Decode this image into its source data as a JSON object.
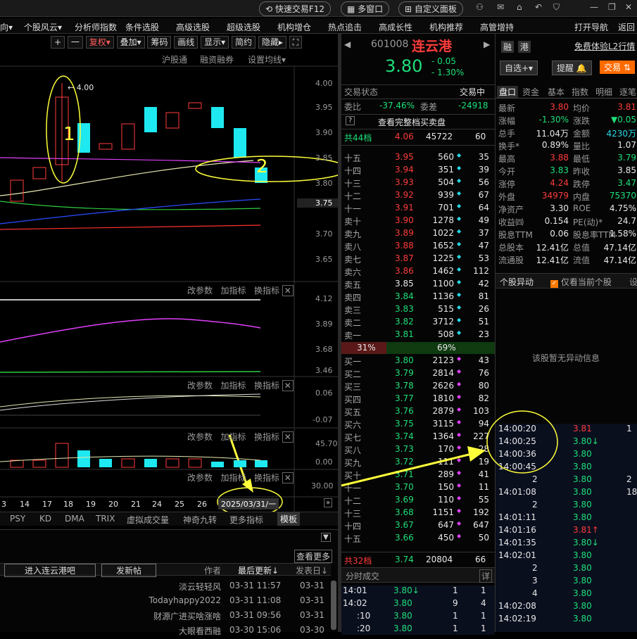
{
  "topbar": {
    "buttons": [
      "快速交易F12",
      "多窗口",
      "自定义面板"
    ]
  },
  "menubar": {
    "items": [
      "向▾",
      "个股风云▾",
      "分析师指数",
      "条件选股",
      "高级选股",
      "超级选股",
      "机构增仓",
      "热点追击",
      "高成长性",
      "机构推荐",
      "高管增持"
    ],
    "right_items": [
      "打开导航",
      "返回"
    ]
  },
  "chart_toolbar": {
    "buttons": [
      "+",
      "一",
      "复权▾",
      "叠加▾",
      "筹码",
      "画线",
      "显示▾",
      "简约",
      "隐藏▸"
    ],
    "sub_links": [
      "沪股通",
      "融资融券",
      "设置均线▾"
    ]
  },
  "price_axis": [
    "4.00",
    "3.95",
    "3.90",
    "3.85",
    "3.80",
    "3.75",
    "3.70",
    "3.65"
  ],
  "high_label": "4.00",
  "annotations": [
    "1",
    "2"
  ],
  "indicator_panels": [
    {
      "links": [
        "改参数",
        "加指标",
        "换指标"
      ],
      "axis": [
        "4.12",
        "3.89",
        "3.68",
        "3.46"
      ]
    },
    {
      "links": [
        "改参数",
        "加指标",
        "换指标"
      ],
      "axis": [
        "0.06",
        "-0.07"
      ]
    },
    {
      "links": [
        "改参数",
        "加指标",
        "换指标"
      ],
      "axis": [
        "45.70",
        "0.00"
      ]
    },
    {
      "links": [
        "改参数",
        "加指标",
        "换指标"
      ],
      "axis": [
        "30.00"
      ]
    }
  ],
  "date_axis": [
    "3",
    "14",
    "17",
    "18",
    "19",
    "20",
    "21",
    "24",
    "25",
    "26"
  ],
  "date_box": "2025/03/31/一",
  "indicator_tabs": [
    "PSY",
    "KD",
    "DMA",
    "TRIX",
    "虚拟成交量",
    "神奇九转",
    "更多指标",
    "模板"
  ],
  "forum": {
    "view_more": "查看更多",
    "enter_btn": "进入连云港吧",
    "post_btn": "发新帖",
    "headers": [
      "作者",
      "最后更新↓",
      "发表日↓"
    ],
    "rows": [
      {
        "author": "淡云轻轻风",
        "updated": "03-31 11:57",
        "posted": "03-31"
      },
      {
        "author": "Todayhappy2022",
        "updated": "03-31 11:08",
        "posted": "03-31"
      },
      {
        "author": "财源广进买啥涨啥",
        "updated": "03-31 09:56",
        "posted": "03-31"
      },
      {
        "author": "大眼看西融",
        "updated": "03-30 15:06",
        "posted": "03-30"
      }
    ]
  },
  "stock": {
    "code": "601008",
    "name": "连云港",
    "price": "3.80",
    "change": "- 0.05",
    "change_pct": "- 1.30%",
    "status_label": "交易状态",
    "status": "交易中",
    "weibi_label": "委比",
    "weibi": "-37.46%",
    "weicha_label": "委差",
    "weicha": "-24918",
    "full_depth": "查看完整档买卖盘",
    "sell_total_label": "共44档",
    "sell_total_price": "4.06",
    "sell_total_vol": "45722",
    "sell_total_n": "60",
    "buy_total_label": "共32档",
    "buy_total_price": "3.74",
    "buy_total_vol": "20804",
    "buy_total_n": "66",
    "ratio_sell": "31%",
    "ratio_buy": "69%"
  },
  "asks": [
    {
      "label": "十五",
      "price": "3.95",
      "vol": "560",
      "n": "35"
    },
    {
      "label": "十四",
      "price": "3.94",
      "vol": "351",
      "n": "39"
    },
    {
      "label": "十三",
      "price": "3.93",
      "vol": "504",
      "n": "56"
    },
    {
      "label": "十二",
      "price": "3.92",
      "vol": "939",
      "n": "67"
    },
    {
      "label": "十一",
      "price": "3.91",
      "vol": "701",
      "n": "64"
    },
    {
      "label": "卖十",
      "price": "3.90",
      "vol": "1278",
      "n": "49"
    },
    {
      "label": "卖九",
      "price": "3.89",
      "vol": "1022",
      "n": "37"
    },
    {
      "label": "卖八",
      "price": "3.88",
      "vol": "1652",
      "n": "47"
    },
    {
      "label": "卖七",
      "price": "3.87",
      "vol": "1225",
      "n": "53"
    },
    {
      "label": "卖六",
      "price": "3.86",
      "vol": "1462",
      "n": "112"
    },
    {
      "label": "卖五",
      "price": "3.85",
      "vol": "1100",
      "n": "42"
    },
    {
      "label": "卖四",
      "price": "3.84",
      "vol": "1136",
      "n": "81"
    },
    {
      "label": "卖三",
      "price": "3.83",
      "vol": "515",
      "n": "26"
    },
    {
      "label": "卖二",
      "price": "3.82",
      "vol": "3712",
      "n": "51"
    },
    {
      "label": "卖一",
      "price": "3.81",
      "vol": "508",
      "n": "23"
    }
  ],
  "bids": [
    {
      "label": "买一",
      "price": "3.80",
      "vol": "2123",
      "n": "43"
    },
    {
      "label": "买二",
      "price": "3.79",
      "vol": "2814",
      "n": "76"
    },
    {
      "label": "买三",
      "price": "3.78",
      "vol": "2626",
      "n": "80"
    },
    {
      "label": "买四",
      "price": "3.77",
      "vol": "1810",
      "n": "82"
    },
    {
      "label": "买五",
      "price": "3.76",
      "vol": "2879",
      "n": "103"
    },
    {
      "label": "买六",
      "price": "3.75",
      "vol": "3115",
      "n": "94"
    },
    {
      "label": "买七",
      "price": "3.74",
      "vol": "1364",
      "n": "227"
    },
    {
      "label": "买八",
      "price": "3.73",
      "vol": "170",
      "n": "28"
    },
    {
      "label": "买九",
      "price": "3.72",
      "vol": "111",
      "n": "19"
    },
    {
      "label": "买十",
      "price": "3.71",
      "vol": "289",
      "n": "41"
    },
    {
      "label": "十一",
      "price": "3.70",
      "vol": "150",
      "n": "11"
    },
    {
      "label": "十二",
      "price": "3.69",
      "vol": "110",
      "n": "55"
    },
    {
      "label": "十三",
      "price": "3.68",
      "vol": "1151",
      "n": "192"
    },
    {
      "label": "十四",
      "price": "3.67",
      "vol": "647",
      "n": "647"
    },
    {
      "label": "十五",
      "price": "3.66",
      "vol": "450",
      "n": "50"
    }
  ],
  "ticks_mid": {
    "title": "分时成交",
    "detail": "详",
    "rows": [
      {
        "time": "14:01",
        "price": "3.80↓",
        "vol": "1",
        "n": "1"
      },
      {
        "time": "14:02",
        "price": "3.80",
        "vol": "9",
        "n": "4"
      },
      {
        "time": ":10",
        "price": "3.80",
        "vol": "1",
        "n": "1"
      },
      {
        "time": ":20",
        "price": "3.80",
        "vol": "1",
        "n": "1"
      }
    ]
  },
  "right_panel": {
    "badges": [
      "融",
      "港"
    ],
    "l2_link": "免费体验L2行情",
    "buttons": [
      "自选+▾",
      "提醒",
      "交易"
    ],
    "tabs": [
      "盘口",
      "资金",
      "基本",
      "指数",
      "明细",
      "逐笔"
    ],
    "stats": [
      {
        "k1": "最新",
        "v1": "3.80",
        "c1": "red",
        "k2": "均价",
        "v2": "3.81",
        "c2": "red"
      },
      {
        "k1": "涨幅",
        "v1": "-1.30%",
        "c1": "green",
        "k2": "涨跌",
        "v2": "▼0.05",
        "c2": "green"
      },
      {
        "k1": "总手",
        "v1": "11.04万",
        "c1": "white",
        "k2": "金额",
        "v2": "4230万",
        "c2": "cyan"
      },
      {
        "k1": "换手*",
        "v1": "0.89%",
        "c1": "white",
        "k2": "量比",
        "v2": "1.07",
        "c2": "white"
      },
      {
        "k1": "最高",
        "v1": "3.88",
        "c1": "red",
        "k2": "最低",
        "v2": "3.79",
        "c2": "green"
      },
      {
        "k1": "今开",
        "v1": "3.83",
        "c1": "green",
        "k2": "昨收",
        "v2": "3.85",
        "c2": "white"
      },
      {
        "k1": "涨停",
        "v1": "4.24",
        "c1": "red",
        "k2": "跌停",
        "v2": "3.47",
        "c2": "green"
      },
      {
        "k1": "外盘",
        "v1": "34979",
        "c1": "red",
        "k2": "内盘",
        "v2": "75370",
        "c2": "green"
      },
      {
        "k1": "净资产",
        "v1": "3.30",
        "c1": "white",
        "k2": "ROE",
        "v2": "4.75%",
        "c2": "white"
      },
      {
        "k1": "收益㈣",
        "v1": "0.154",
        "c1": "white",
        "k2": "PE(动)*",
        "v2": "24.7",
        "c2": "white"
      },
      {
        "k1": "股息TTM",
        "v1": "0.06",
        "c1": "white",
        "k2": "股息率TTM",
        "v2": "1.58%",
        "c2": "white"
      },
      {
        "k1": "总股本",
        "v1": "12.41亿",
        "c1": "white",
        "k2": "总值",
        "v2": "47.14亿",
        "c2": "white"
      },
      {
        "k1": "流通股",
        "v1": "12.41亿",
        "c1": "white",
        "k2": "流值",
        "v2": "47.14亿",
        "c2": "white"
      }
    ],
    "anomaly_title": "个股异动",
    "anomaly_check": "仅看当前个股",
    "anomaly_more": "设",
    "anomaly_empty": "该股暂无异动信息",
    "ticks": [
      {
        "time": "14:00:20",
        "price": "3.81",
        "pc": "red",
        "vol": "1"
      },
      {
        "time": "14:00:25",
        "price": "3.80↓",
        "pc": "green",
        "vol": ""
      },
      {
        "time": "14:00:36",
        "price": "3.80",
        "pc": "green",
        "vol": ""
      },
      {
        "time": "14:00:45",
        "price": "3.80",
        "pc": "green",
        "vol": ""
      },
      {
        "time": "2",
        "price": "3.80",
        "pc": "green",
        "vol": "2"
      },
      {
        "time": "14:01:08",
        "price": "3.80",
        "pc": "green",
        "vol": "18"
      },
      {
        "time": "2",
        "price": "3.80",
        "pc": "green",
        "vol": ""
      },
      {
        "time": "14:01:11",
        "price": "3.80",
        "pc": "green",
        "vol": ""
      },
      {
        "time": "14:01:16",
        "price": "3.81↑",
        "pc": "red",
        "vol": ""
      },
      {
        "time": "14:01:35",
        "price": "3.80↓",
        "pc": "green",
        "vol": ""
      },
      {
        "time": "14:02:01",
        "price": "3.80",
        "pc": "green",
        "vol": ""
      },
      {
        "time": "2",
        "price": "3.80",
        "pc": "green",
        "vol": ""
      },
      {
        "time": "3",
        "price": "3.80",
        "pc": "green",
        "vol": ""
      },
      {
        "time": "4",
        "price": "3.80",
        "pc": "green",
        "vol": ""
      },
      {
        "time": "14:02:08",
        "price": "3.80",
        "pc": "green",
        "vol": ""
      },
      {
        "time": "14:02:19",
        "price": "3.80",
        "pc": "green",
        "vol": ""
      }
    ]
  },
  "colors": {
    "up": "#ff3b3b",
    "down": "#1ee07a",
    "candle_down": "#1ee8f0",
    "annot": "#ffff3b"
  }
}
